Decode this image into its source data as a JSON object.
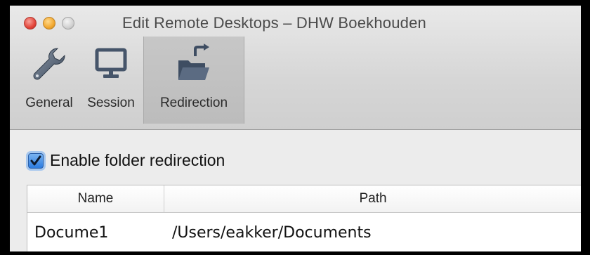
{
  "window": {
    "title": "Edit Remote Desktops – DHW Boekhouden",
    "controls": [
      "close-icon",
      "minimize-icon",
      "zoom-icon"
    ]
  },
  "toolbar": {
    "items": [
      {
        "label": "General",
        "icon": "wrench-icon",
        "selected": false
      },
      {
        "label": "Session",
        "icon": "monitor-icon",
        "selected": false
      },
      {
        "label": "Redirection",
        "icon": "folder-redirect-icon",
        "selected": true
      }
    ]
  },
  "redirection": {
    "enable_label": "Enable folder redirection",
    "enabled": true,
    "table": {
      "columns": [
        "Name",
        "Path"
      ],
      "rows": [
        {
          "name": "Docume1",
          "path": "/Users/eakker/Documents"
        }
      ]
    }
  },
  "colors": {
    "accent": "#2d7ce0",
    "window_bg": "#ececec",
    "selected_tab": "#c2c2c2"
  }
}
